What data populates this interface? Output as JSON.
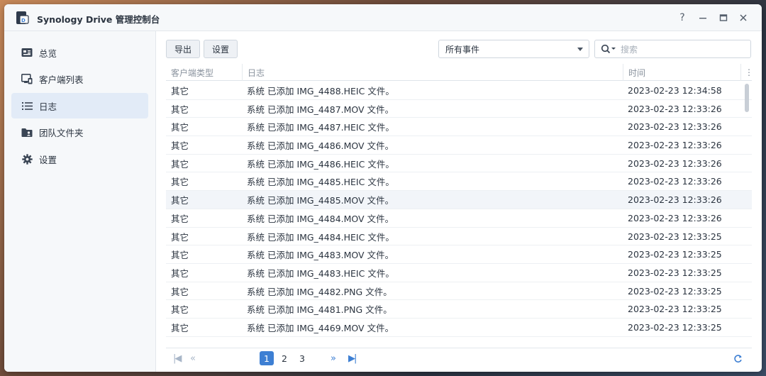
{
  "window": {
    "title": "Synology Drive 管理控制台",
    "controls": {
      "help": "?",
      "minimize": "—",
      "maximize": "▭",
      "close": "✕"
    }
  },
  "sidebar": {
    "items": [
      {
        "label": "总览",
        "icon": "overview-icon",
        "active": false
      },
      {
        "label": "客户端列表",
        "icon": "client-list-icon",
        "active": false
      },
      {
        "label": "日志",
        "icon": "log-list-icon",
        "active": true
      },
      {
        "label": "团队文件夹",
        "icon": "team-folder-icon",
        "active": false
      },
      {
        "label": "设置",
        "icon": "gear-icon",
        "active": false
      }
    ]
  },
  "toolbar": {
    "export_label": "导出",
    "settings_label": "设置",
    "event_filter": {
      "selected": "所有事件"
    },
    "search": {
      "placeholder": "搜索"
    }
  },
  "table": {
    "columns": [
      "客户端类型",
      "日志",
      "时间"
    ],
    "rows": [
      [
        "其它",
        "系统 已添加 IMG_4488.HEIC 文件。",
        "2023-02-23 12:34:58"
      ],
      [
        "其它",
        "系统 已添加 IMG_4487.MOV 文件。",
        "2023-02-23 12:33:26"
      ],
      [
        "其它",
        "系统 已添加 IMG_4487.HEIC 文件。",
        "2023-02-23 12:33:26"
      ],
      [
        "其它",
        "系统 已添加 IMG_4486.MOV 文件。",
        "2023-02-23 12:33:26"
      ],
      [
        "其它",
        "系统 已添加 IMG_4486.HEIC 文件。",
        "2023-02-23 12:33:26"
      ],
      [
        "其它",
        "系统 已添加 IMG_4485.HEIC 文件。",
        "2023-02-23 12:33:26"
      ],
      [
        "其它",
        "系统 已添加 IMG_4485.MOV 文件。",
        "2023-02-23 12:33:26"
      ],
      [
        "其它",
        "系统 已添加 IMG_4484.MOV 文件。",
        "2023-02-23 12:33:26"
      ],
      [
        "其它",
        "系统 已添加 IMG_4484.HEIC 文件。",
        "2023-02-23 12:33:25"
      ],
      [
        "其它",
        "系统 已添加 IMG_4483.MOV 文件。",
        "2023-02-23 12:33:25"
      ],
      [
        "其它",
        "系统 已添加 IMG_4483.HEIC 文件。",
        "2023-02-23 12:33:25"
      ],
      [
        "其它",
        "系统 已添加 IMG_4482.PNG 文件。",
        "2023-02-23 12:33:25"
      ],
      [
        "其它",
        "系统 已添加 IMG_4481.PNG 文件。",
        "2023-02-23 12:33:25"
      ],
      [
        "其它",
        "系统 已添加 IMG_4469.MOV 文件。",
        "2023-02-23 12:33:25"
      ]
    ],
    "highlighted_row": 6
  },
  "pager": {
    "pages": [
      "1",
      "2",
      "3"
    ],
    "current": "1"
  },
  "colors": {
    "accent": "#3d7fd3",
    "sidebar_active": "#e2ebf7",
    "sidebar_bg": "#f6f8fa"
  }
}
